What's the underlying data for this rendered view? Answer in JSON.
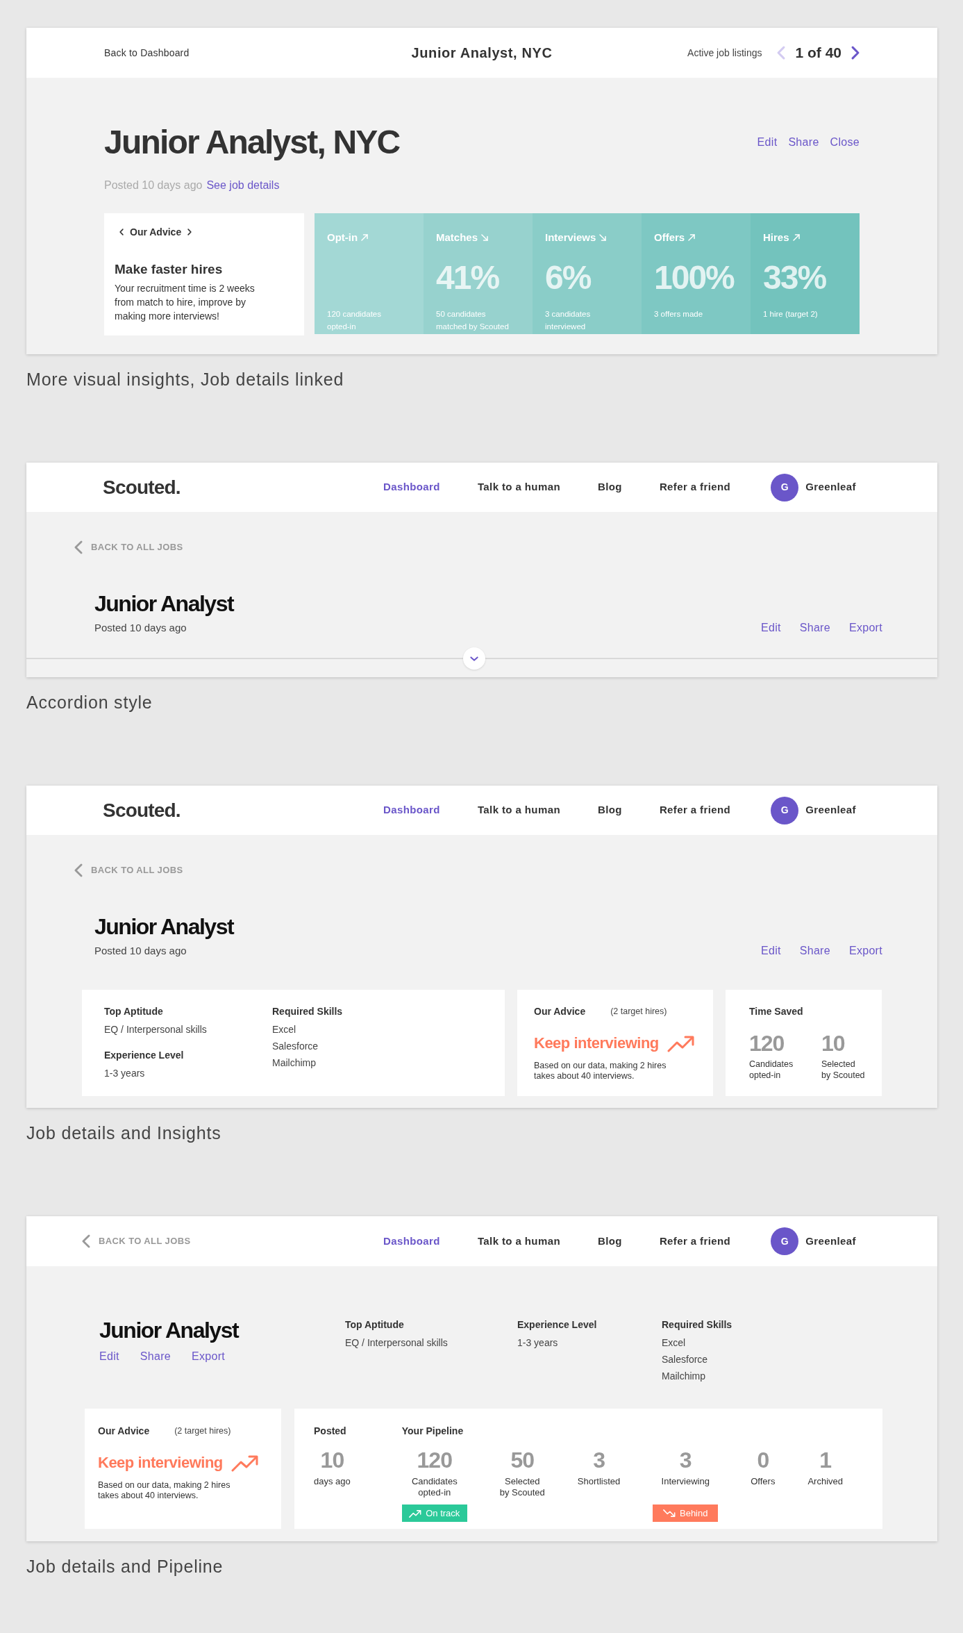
{
  "sections": [
    {
      "kind": "insights",
      "topbar": {
        "back_link": "Back to Dashboard",
        "title": "Junior Analyst, NYC",
        "listings_label": "Active job listings",
        "prev": {
          "disabled": true
        },
        "pager": "1 of 40",
        "next": {
          "disabled": false
        }
      },
      "job": {
        "title": "Junior Analyst, NYC",
        "actions": [
          "Edit",
          "Share",
          "Close"
        ],
        "posted": "Posted 10 days ago",
        "details_link": "See job details"
      },
      "advice": {
        "heading": "Our Advice",
        "title": "Make faster hires",
        "text": "Your recruitment time is 2 weeks\nfrom match to hire, improve by\nmaking more interviews!"
      },
      "stats": [
        {
          "label": "Opt-in",
          "rising": true,
          "note": "120 candidates\nopted-in",
          "color": "#a3d8d5"
        },
        {
          "label": "Matches",
          "rising": false,
          "value": "41%",
          "note": "50 candidates\nmatched by Scouted",
          "color": "#97d2ce"
        },
        {
          "label": "Interviews",
          "rising": false,
          "value": "6%",
          "note": "3 candidates\ninterviewed",
          "color": "#8acdc8"
        },
        {
          "label": "Offers",
          "rising": true,
          "value": "100%",
          "note": "3 offers made",
          "color": "#7ec8c3"
        },
        {
          "label": "Hires",
          "rising": true,
          "value": "33%",
          "note": "1 hire (target 2)",
          "color": "#73c3bd"
        }
      ],
      "caption": "More visual insights, Job details linked"
    },
    {
      "kind": "accordion",
      "nav": {
        "logo": "Scouted.",
        "items": [
          {
            "label": "Dashboard",
            "selected": true
          },
          {
            "label": "Talk to a human",
            "selected": false
          },
          {
            "label": "Blog",
            "selected": false
          },
          {
            "label": "Refer a friend",
            "selected": false
          }
        ],
        "user": {
          "initial": "G",
          "name": "Greenleaf"
        }
      },
      "back_link": "BACK TO ALL JOBS",
      "job": {
        "title": "Junior Analyst",
        "posted": "Posted 10 days ago",
        "actions": [
          "Edit",
          "Share",
          "Export"
        ]
      },
      "accordion": {
        "expanded": false
      },
      "caption": "Accordion style"
    },
    {
      "kind": "details_insights",
      "nav": {
        "logo": "Scouted.",
        "items": [
          {
            "label": "Dashboard",
            "selected": true
          },
          {
            "label": "Talk to a human",
            "selected": false
          },
          {
            "label": "Blog",
            "selected": false
          },
          {
            "label": "Refer a friend",
            "selected": false
          }
        ],
        "user": {
          "initial": "G",
          "name": "Greenleaf"
        }
      },
      "back_link": "BACK TO ALL JOBS",
      "job": {
        "title": "Junior Analyst",
        "posted": "Posted 10 days ago",
        "actions": [
          "Edit",
          "Share",
          "Export"
        ]
      },
      "details": {
        "columns": [
          [
            {
              "label": "Top Aptitude",
              "values": [
                "EQ / Interpersonal skills"
              ]
            },
            {
              "label": "Experience Level",
              "values": [
                "1-3 years"
              ]
            }
          ],
          [
            {
              "label": "Required Skills",
              "values": [
                "Excel",
                "Salesforce",
                "Mailchimp"
              ]
            }
          ]
        ]
      },
      "advice": {
        "heading": "Our Advice",
        "note": "(2 target hires)",
        "title": "Keep interviewing",
        "rising": true,
        "text": "Based on our data, making 2 hires\ntakes about 40 interviews."
      },
      "time_saved": {
        "heading": "Time Saved",
        "metrics": [
          {
            "value": "120",
            "label": "Candidates\nopted-in"
          },
          {
            "value": "10",
            "label": "Selected\nby Scouted"
          }
        ]
      },
      "caption": "Job details and Insights"
    },
    {
      "kind": "details_pipeline",
      "nav": {
        "back_link": "BACK TO ALL JOBS",
        "items": [
          {
            "label": "Dashboard",
            "selected": true
          },
          {
            "label": "Talk to a human",
            "selected": false
          },
          {
            "label": "Blog",
            "selected": false
          },
          {
            "label": "Refer a friend",
            "selected": false
          }
        ],
        "user": {
          "initial": "G",
          "name": "Greenleaf"
        }
      },
      "job": {
        "title": "Junior Analyst",
        "actions": [
          "Edit",
          "Share",
          "Export"
        ]
      },
      "details": {
        "columns": [
          [
            {
              "label": "Top Aptitude",
              "values": [
                "EQ / Interpersonal skills"
              ]
            }
          ],
          [
            {
              "label": "Experience Level",
              "values": [
                "1-3 years"
              ]
            }
          ],
          [
            {
              "label": "Required Skills",
              "values": [
                "Excel",
                "Salesforce",
                "Mailchimp"
              ]
            }
          ]
        ]
      },
      "advice": {
        "heading": "Our Advice",
        "note": "(2 target hires)",
        "title": "Keep interviewing",
        "rising": true,
        "text": "Based on our data, making 2 hires\ntakes about 40 interviews."
      },
      "posted": {
        "heading": "Posted",
        "value": "10",
        "label": "days ago"
      },
      "pipeline": {
        "heading": "Your Pipeline",
        "stages": [
          {
            "value": "120",
            "label": "Candidates\nopted-in",
            "status": {
              "kind": "on_track",
              "label": "On track"
            }
          },
          {
            "value": "50",
            "label": "Selected\nby Scouted"
          },
          {
            "value": "3",
            "label": "Shortlisted"
          },
          {
            "value": "3",
            "label": "Interviewing",
            "status": {
              "kind": "behind",
              "label": "Behind"
            }
          },
          {
            "value": "0",
            "label": "Offers"
          },
          {
            "value": "1",
            "label": "Archived"
          }
        ]
      },
      "caption": "Job details and Pipeline"
    }
  ]
}
